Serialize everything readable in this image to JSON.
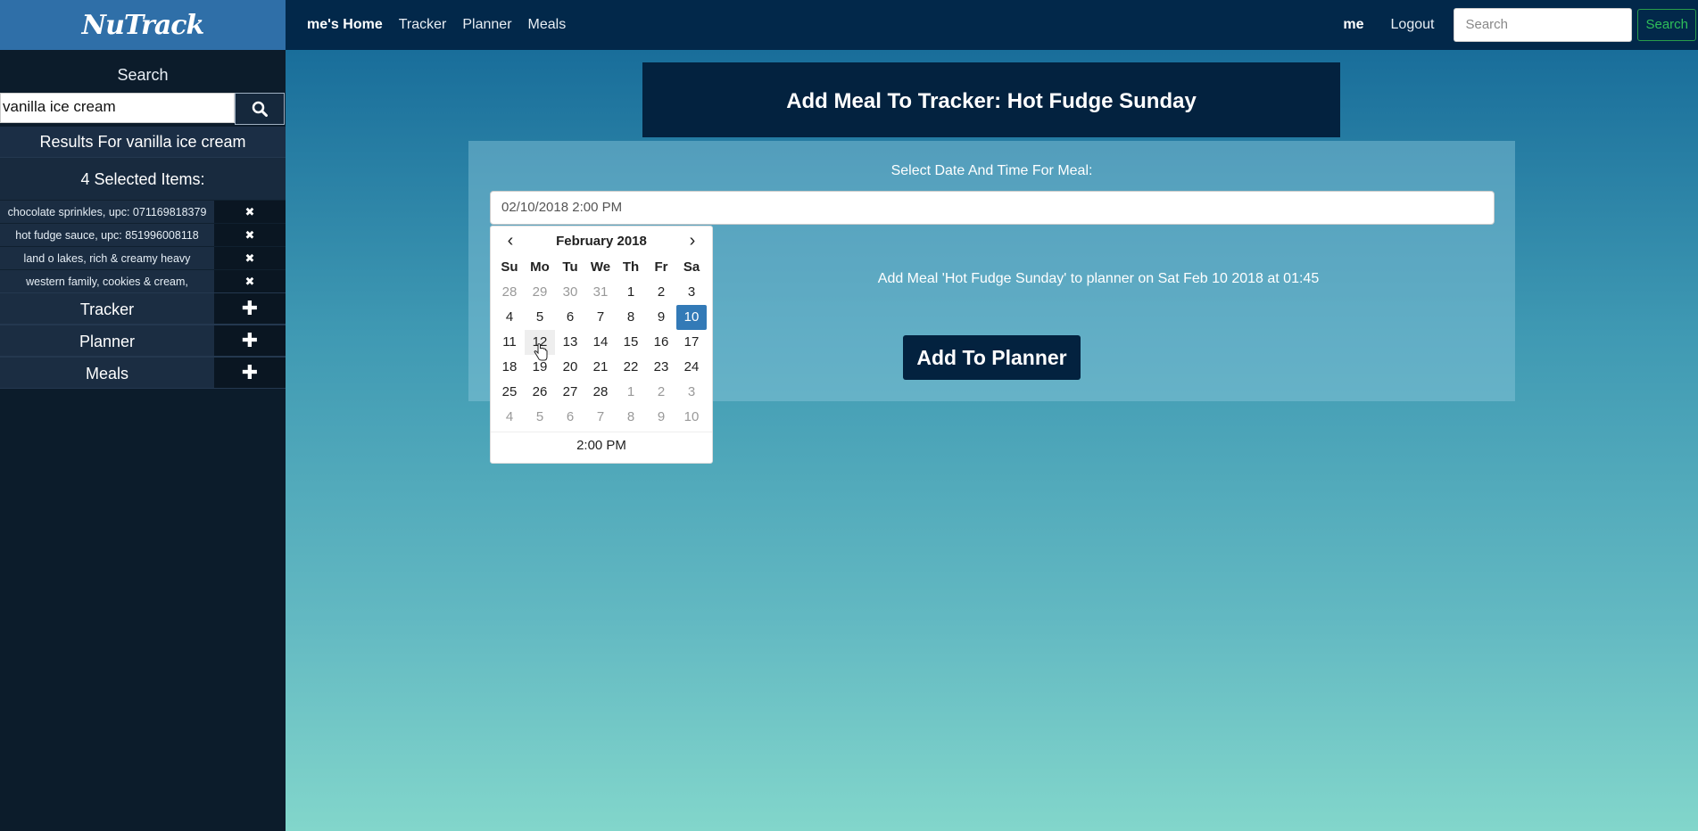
{
  "brand": "NuTrack",
  "sidebar": {
    "search_label": "Search",
    "search_value": "vanilla ice cream",
    "results_label": "Results For vanilla ice cream",
    "selected_header": "4 Selected Items:",
    "selected_items": [
      {
        "label": "chocolate sprinkles, upc: 071169818379",
        "remove": "✖"
      },
      {
        "label": "hot fudge sauce, upc: 851996008118",
        "remove": "✖"
      },
      {
        "label": "land o lakes, rich & creamy heavy",
        "remove": "✖"
      },
      {
        "label": "western family, cookies & cream,",
        "remove": "✖"
      }
    ],
    "sections": [
      {
        "label": "Tracker",
        "toggle": "✚"
      },
      {
        "label": "Planner",
        "toggle": "✚"
      },
      {
        "label": "Meals",
        "toggle": "✚"
      }
    ]
  },
  "nav": {
    "home": "me's Home",
    "tracker": "Tracker",
    "planner": "Planner",
    "meals": "Meals",
    "user": "me",
    "logout": "Logout",
    "search_placeholder": "Search",
    "search_button": "Search"
  },
  "main": {
    "title": "Add Meal To Tracker: Hot Fudge Sunday",
    "date_label": "Select Date And Time For Meal:",
    "date_value": "02/10/2018 2:00 PM",
    "info": "Add Meal 'Hot Fudge Sunday' to planner on Sat Feb 10 2018 at 01:45",
    "add_button": "Add To Planner"
  },
  "calendar": {
    "title": "February 2018",
    "prev": "‹",
    "next": "›",
    "days_of_week": [
      "Su",
      "Mo",
      "Tu",
      "We",
      "Th",
      "Fr",
      "Sa"
    ],
    "weeks": [
      [
        "28",
        "29",
        "30",
        "31",
        "1",
        "2",
        "3"
      ],
      [
        "4",
        "5",
        "6",
        "7",
        "8",
        "9",
        "10"
      ],
      [
        "11",
        "12",
        "13",
        "14",
        "15",
        "16",
        "17"
      ],
      [
        "18",
        "19",
        "20",
        "21",
        "22",
        "23",
        "24"
      ],
      [
        "25",
        "26",
        "27",
        "28",
        "1",
        "2",
        "3"
      ],
      [
        "4",
        "5",
        "6",
        "7",
        "8",
        "9",
        "10"
      ]
    ],
    "selected_day": "10",
    "time": "2:00 PM"
  },
  "colors": {
    "sidebar_bg": "#0c1c2b",
    "nav_bg": "#02284a",
    "brand_bg": "#2f6fa8",
    "selected_day": "#337ab7",
    "search_btn": "#2fbf5a"
  }
}
